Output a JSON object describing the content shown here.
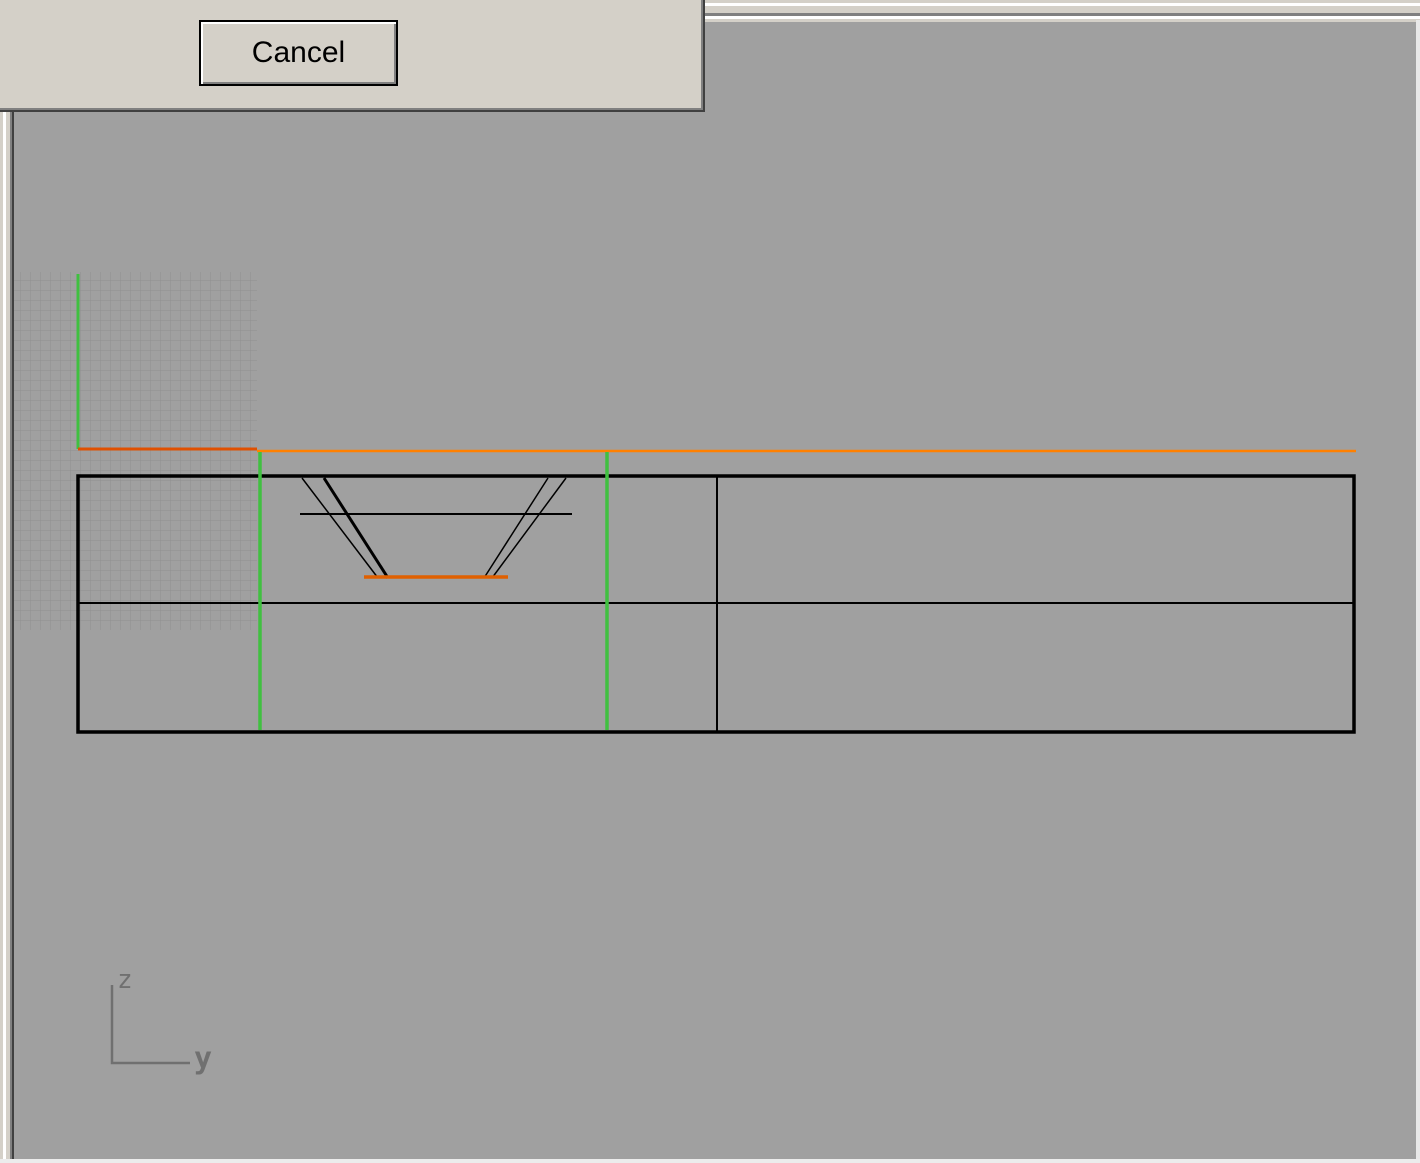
{
  "dialog": {
    "cancel_label": "Cancel"
  },
  "viewport": {
    "background_color": "#a0a0a0",
    "axis_labels": {
      "vertical": "z",
      "horizontal": "y"
    },
    "colors": {
      "outline": "#000000",
      "highlight_orange": "#ff8000",
      "highlight_green": "#40c040",
      "grid": "#8c8c8c",
      "axis_widget": "#707070"
    }
  }
}
